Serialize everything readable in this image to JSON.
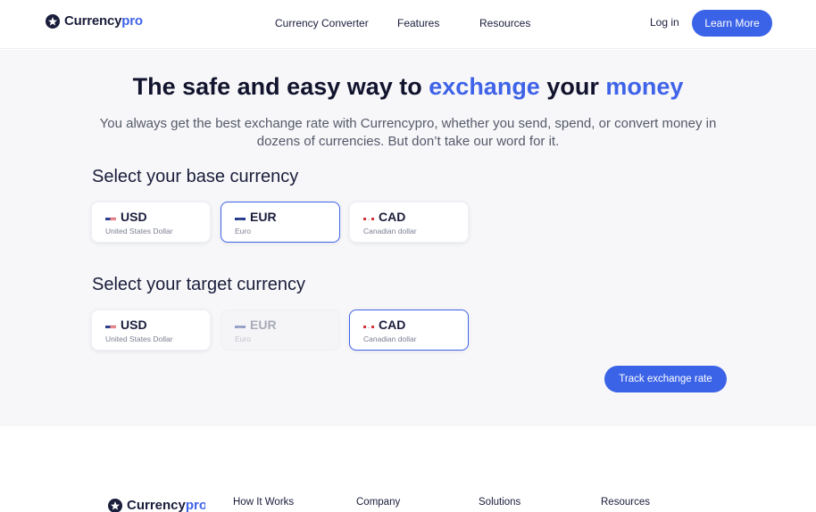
{
  "header": {
    "brand_part1": "Currency",
    "brand_part2": "pro",
    "nav": [
      "Currency Converter",
      "Features",
      "Resources"
    ],
    "login_label": "Log in",
    "cta_label": "Learn More"
  },
  "hero": {
    "title_part1": "The safe and easy way to ",
    "title_accent1": "exchange",
    "title_part2": " your ",
    "title_accent2": "money",
    "subtitle": "You always get the best exchange rate with Currencypro, whether you send, spend, or convert money in dozens of currencies. But don’t take our word for it."
  },
  "base": {
    "label": "Select your base currency",
    "selected": "EUR",
    "options": [
      {
        "code": "USD",
        "name": "United States Dollar",
        "flag": "us-flag-icon"
      },
      {
        "code": "EUR",
        "name": "Euro",
        "flag": "eu-flag-icon"
      },
      {
        "code": "CAD",
        "name": "Canadian dollar",
        "flag": "ca-flag-icon"
      }
    ]
  },
  "target": {
    "label": "Select your target currency",
    "selected": "CAD",
    "disabled": "EUR",
    "options": [
      {
        "code": "USD",
        "name": "United States Dollar",
        "flag": "us-flag-icon"
      },
      {
        "code": "EUR",
        "name": "Euro",
        "flag": "eu-flag-icon"
      },
      {
        "code": "CAD",
        "name": "Canadian dollar",
        "flag": "ca-flag-icon"
      }
    ]
  },
  "track_label": "Track exchange rate",
  "footer": {
    "brand_part1": "Currency",
    "brand_part2": "pro",
    "columns": [
      "How It Works",
      "Company",
      "Solutions",
      "Resources"
    ]
  },
  "colors": {
    "accent": "#3f63e8",
    "button": "#3b63e7",
    "hero_bg": "#f7f7f9",
    "text": "#1a1d3b"
  }
}
